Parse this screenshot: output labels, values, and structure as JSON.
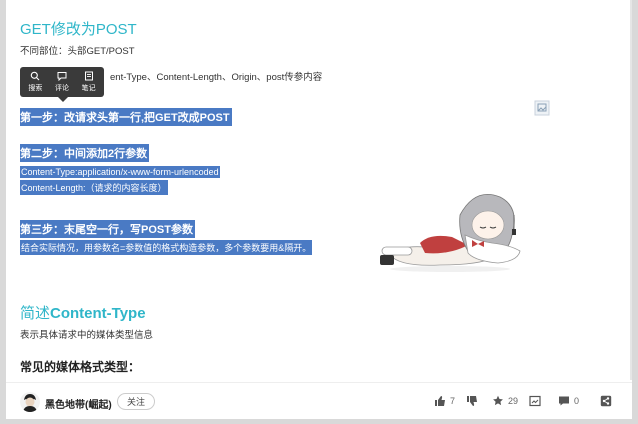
{
  "article": {
    "heading_main": "GET修改为POST",
    "diff_text": "不同部位：头部GET/POST",
    "partial_line": "ent-Type、Content-Length、Origin、post传参内容",
    "step1": "第一步：改请求头第一行,把GET改成POST",
    "step2": "第二步：中间添加2行参数",
    "param1": "Content-Type:application/x-www-form-urlencoded",
    "param2": "Content-Length:（请求的内容长度）",
    "step3": "第三步：末尾空一行，写POST参数",
    "step3_note": "结合实际情况，用参数名=参数值的格式构造参数，多个参数要用&隔开。",
    "heading_ct_prefix": "简述",
    "heading_ct_bold": "Content-Type",
    "ct_desc": "表示具体请求中的媒体类型信息",
    "subheading": "常见的媒体格式类型："
  },
  "tooltip": {
    "items": [
      {
        "icon": "search-icon",
        "label": "搜索"
      },
      {
        "icon": "comment-icon",
        "label": "评论"
      },
      {
        "icon": "note-icon",
        "label": "笔记"
      }
    ]
  },
  "bottombar": {
    "author": "黑色地带(崛起)",
    "follow_label": "关注",
    "like_count": "7",
    "dislike_count": "",
    "fav_count": "29",
    "comment_count": "0"
  },
  "colors": {
    "heading": "#2fb6c9",
    "highlight": "#4a7ac4"
  }
}
